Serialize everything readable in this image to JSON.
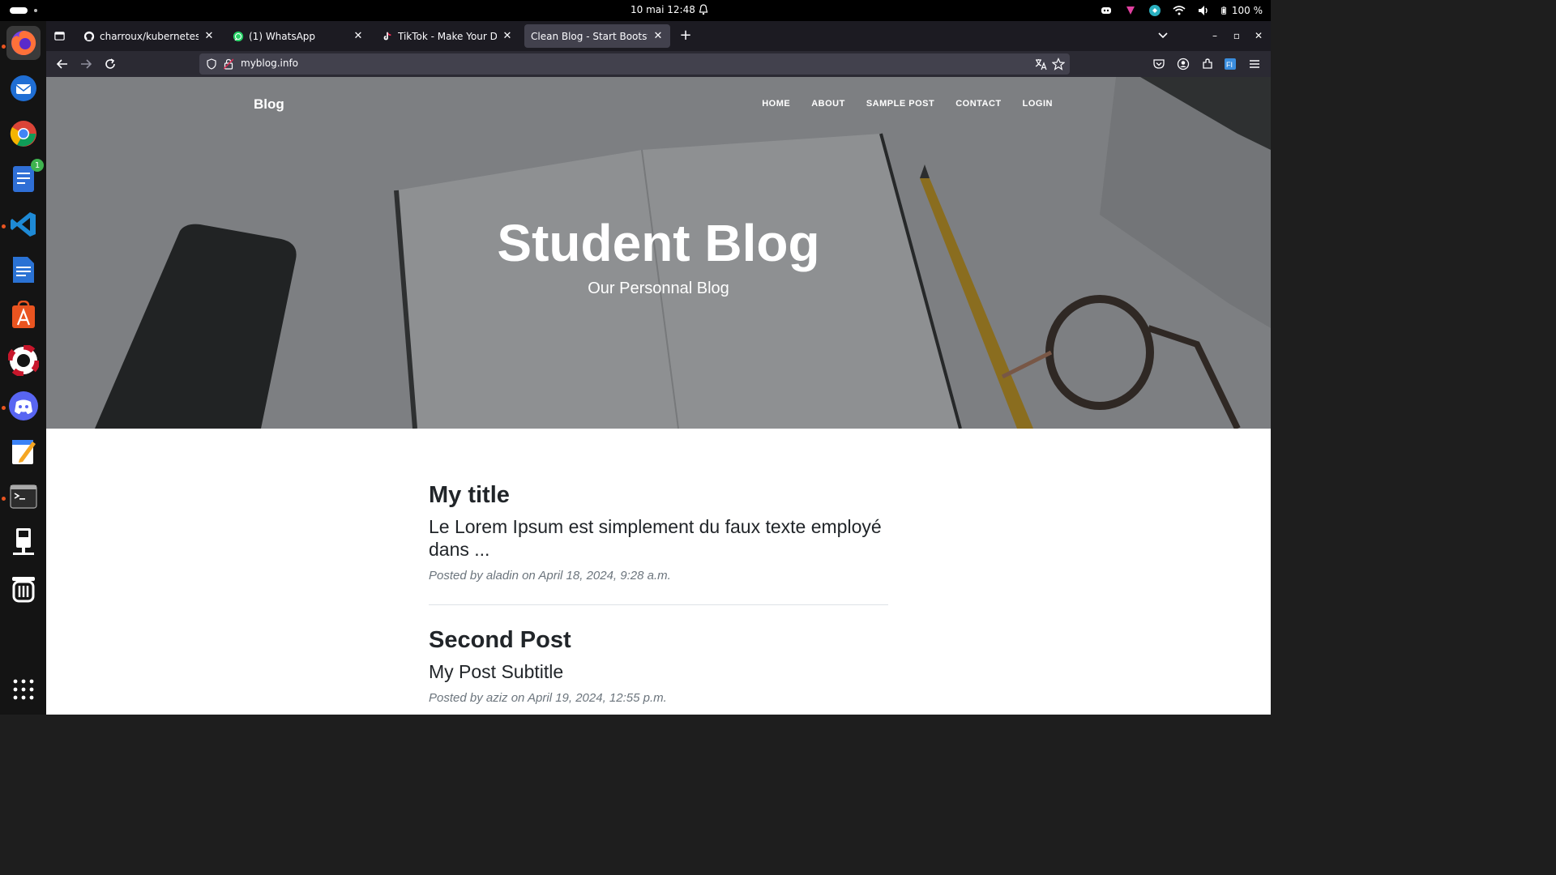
{
  "system": {
    "clock": "10 mai  12:48",
    "battery": "100 %"
  },
  "dock": {
    "items": [
      "firefox-icon",
      "thunderbird-icon",
      "chrome-icon",
      "text-editor-icon",
      "vscode-icon",
      "libreoffice-writer-icon",
      "app-center-icon",
      "help-icon",
      "discord-icon",
      "notes-icon",
      "terminal-icon",
      "remote-desktop-icon",
      "trash-icon",
      "app-grid-icon"
    ],
    "badge_count": "1"
  },
  "tabs": [
    {
      "label": "charroux/kubernetes-minikube",
      "icon": "github-icon"
    },
    {
      "label": "(1) WhatsApp",
      "icon": "whatsapp-icon"
    },
    {
      "label": "TikTok - Make Your Day",
      "icon": "tiktok-icon"
    },
    {
      "label": "Clean Blog - Start Bootstrap",
      "icon": "none"
    }
  ],
  "urlbar": {
    "url": "myblog.info"
  },
  "site": {
    "brand": "Blog",
    "nav": [
      "HOME",
      "ABOUT",
      "SAMPLE POST",
      "CONTACT",
      "LOGIN"
    ],
    "hero_title": "Student Blog",
    "hero_subtitle": "Our Personnal Blog"
  },
  "posts": [
    {
      "title": "My title",
      "subtitle": "Le Lorem Ipsum est simplement du faux texte employé dans ...",
      "meta": "Posted by aladin on April 18, 2024, 9:28 a.m."
    },
    {
      "title": "Second Post",
      "subtitle": "My Post Subtitle",
      "meta": "Posted by aziz on April 19, 2024, 12:55 p.m."
    }
  ],
  "colors": {
    "accent": "#e95420",
    "tab_selected": "#42414d",
    "toolbar": "#2b2a33",
    "tabstrip": "#1c1b22"
  }
}
